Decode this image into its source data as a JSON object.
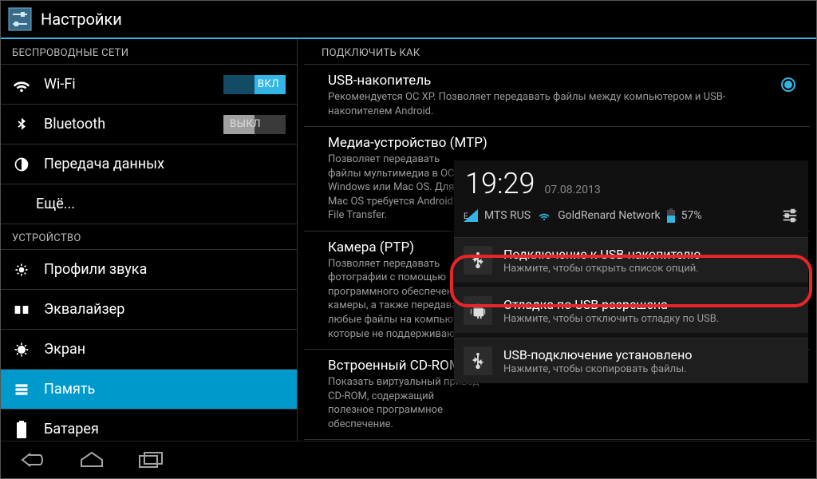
{
  "actionbar": {
    "title": "Настройки"
  },
  "sidebar": {
    "section_wireless": "БЕСПРОВОДНЫЕ СЕТИ",
    "section_device": "УСТРОЙСТВО",
    "wifi": {
      "label": "Wi-Fi",
      "toggle": "ВКЛ"
    },
    "bluetooth": {
      "label": "Bluetooth",
      "toggle": "ВЫКЛ"
    },
    "data": {
      "label": "Передача данных"
    },
    "more": {
      "label": "Ещё..."
    },
    "sound": {
      "label": "Профили звука"
    },
    "eq": {
      "label": "Эквалайзер"
    },
    "display": {
      "label": "Экран"
    },
    "storage": {
      "label": "Память"
    },
    "battery": {
      "label": "Батарея"
    }
  },
  "pane": {
    "header": "ПОДКЛЮЧИТЬ КАК",
    "opts": [
      {
        "title": "USB-накопитель",
        "desc": "Рекомендуется ОС XP. Позволяет передавать файлы между компьютером и USB-накопителем Android.",
        "checked": true
      },
      {
        "title": "Медиа-устройство (MTP)",
        "desc": "Позволяет передавать файлы мультимедиа в ОС Windows или Mac OS. Для Mac OS требуется Android File Transfer."
      },
      {
        "title": "Камера (PTP)",
        "desc": "Позволяет передавать фотографии с помощью программного обеспечения камеры, а также передавать любые файлы на компьютеры, которые не поддерживают MTP"
      },
      {
        "title": "Встроенный CD-ROM",
        "desc": "Показать виртуальный привод CD-ROM, содержащий полезное программное обеспечение."
      }
    ]
  },
  "shade": {
    "time": "19:29",
    "date": "07.08.2013",
    "carrier": "MTS RUS",
    "wifi_name": "GoldRenard Network",
    "battery": "57%",
    "notifs": [
      {
        "title": "Подключение к USB-накопителю",
        "desc": "Нажмите, чтобы открыть список опций.",
        "icon": "usb"
      },
      {
        "title": "Отладка по USB разрешена",
        "desc": "Нажмите, чтобы отключить отладку по USB.",
        "icon": "android"
      },
      {
        "title": "USB-подключение установлено",
        "desc": "Нажмите, чтобы скопировать файлы.",
        "icon": "usb"
      }
    ]
  }
}
